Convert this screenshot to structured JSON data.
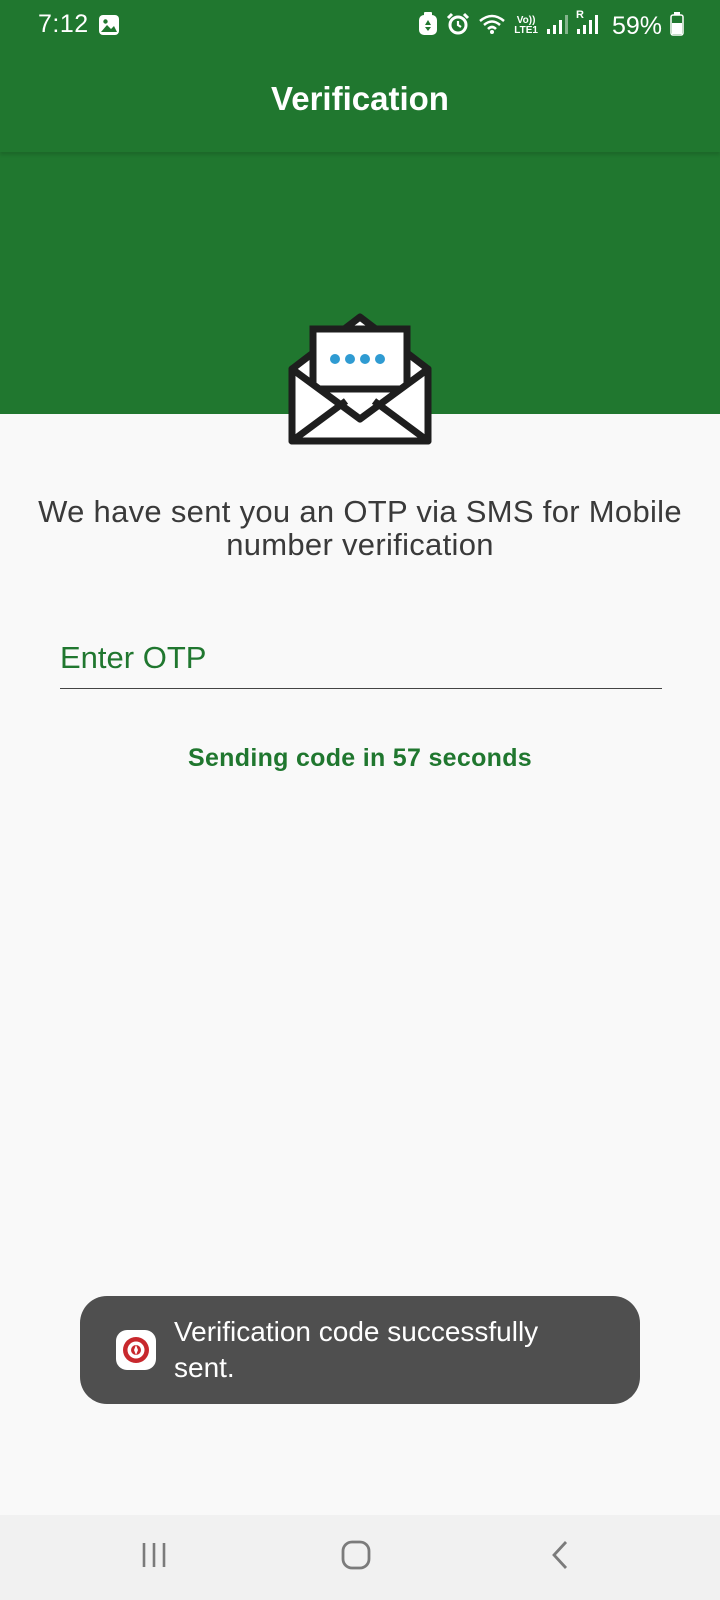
{
  "status_bar": {
    "time": "7:12",
    "battery": "59%",
    "network_top": "Vo))",
    "network_bottom": "LTE1",
    "sim2_label": "R",
    "icons": [
      "gallery-icon",
      "recycle-icon",
      "alarm-icon",
      "wifi-icon",
      "signal-icon",
      "signal-roaming-icon",
      "battery-icon"
    ]
  },
  "app_bar": {
    "title": "Verification"
  },
  "main": {
    "message": "We have sent you an OTP via SMS for Mobile number verification",
    "otp_placeholder": "Enter OTP",
    "otp_value": "",
    "countdown": "Sending code in 57 seconds"
  },
  "toast": {
    "text": "Verification code successfully sent."
  },
  "nav_bar": {
    "icons": [
      "recent-apps-icon",
      "home-icon",
      "back-icon"
    ]
  },
  "colors": {
    "primary": "#20772f",
    "background": "#f9f9f9",
    "toast_bg": "#4f4f4f",
    "envelope_dots": "#2f9bd2"
  }
}
